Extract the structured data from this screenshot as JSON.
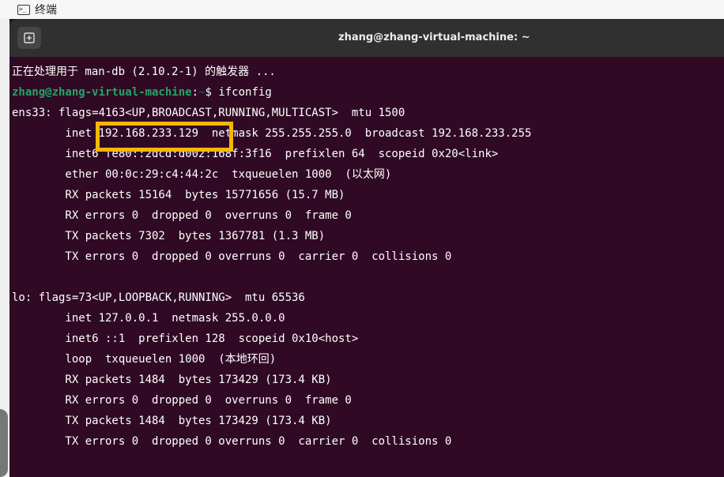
{
  "topbar": {
    "app_name": "终端"
  },
  "window": {
    "title": "zhang@zhang-virtual-machine: ~"
  },
  "prompt": {
    "user_host": "zhang@zhang-virtual-machine",
    "sep": ":",
    "path": "~",
    "dollar": "$ ",
    "command": "ifconfig"
  },
  "terminal_lines": [
    "正在处理用于 man-db (2.10.2-1) 的触发器 ...",
    "ens33: flags=4163<UP,BROADCAST,RUNNING,MULTICAST>  mtu 1500",
    "        inet 192.168.233.129  netmask 255.255.255.0  broadcast 192.168.233.255",
    "        inet6 fe80::2dcd:d002:168f:3f16  prefixlen 64  scopeid 0x20<link>",
    "        ether 00:0c:29:c4:44:2c  txqueuelen 1000  (以太网)",
    "        RX packets 15164  bytes 15771656 (15.7 MB)",
    "        RX errors 0  dropped 0  overruns 0  frame 0",
    "        TX packets 7302  bytes 1367781 (1.3 MB)",
    "        TX errors 0  dropped 0 overruns 0  carrier 0  collisions 0",
    "",
    "lo: flags=73<UP,LOOPBACK,RUNNING>  mtu 65536",
    "        inet 127.0.0.1  netmask 255.0.0.0",
    "        inet6 ::1  prefixlen 128  scopeid 0x10<host>",
    "        loop  txqueuelen 1000  (本地环回)",
    "        RX packets 1484  bytes 173429 (173.4 KB)",
    "        RX errors 0  dropped 0  overruns 0  frame 0",
    "        TX packets 1484  bytes 173429 (173.4 KB)",
    "        TX errors 0  dropped 0 overruns 0  carrier 0  collisions 0"
  ],
  "icons": {
    "app": "terminal-icon",
    "new_tab": "new-tab-icon"
  },
  "colors": {
    "terminal_bg": "#300a24",
    "prompt_user": "#26a269",
    "prompt_path": "#12488b",
    "highlight": "#f5b800"
  }
}
